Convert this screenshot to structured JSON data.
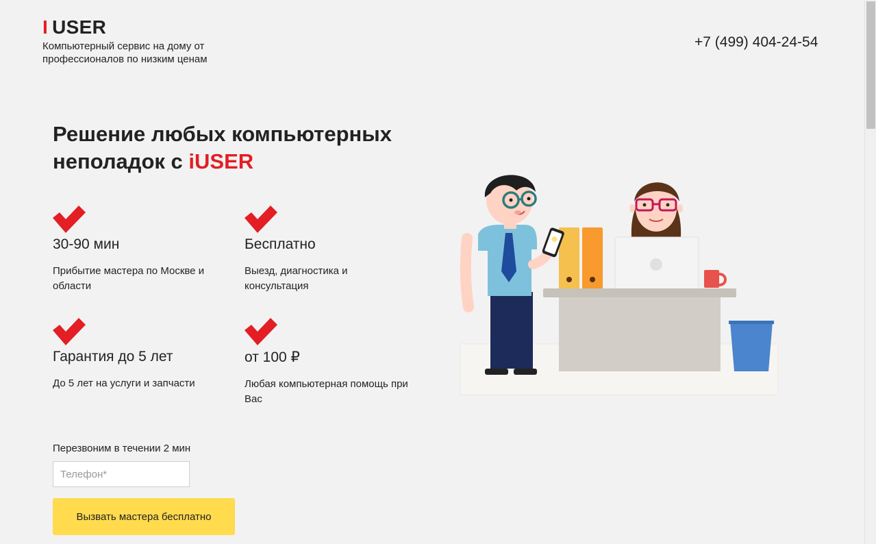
{
  "header": {
    "logo_mark": "I",
    "logo_text": "USER",
    "tagline": "Компьютерный сервис на дому от профессионалов по низким ценам",
    "phone": "+7 (499) 404-24-54"
  },
  "hero": {
    "title_prefix": "Решение любых компьютерных неполадок с ",
    "title_brand": "iUSER"
  },
  "features": [
    {
      "icon": "check-icon",
      "title": "30-90 мин",
      "description": "Прибытие мастера по Москве и области"
    },
    {
      "icon": "check-icon",
      "title": "Бесплатно",
      "description": "Выезд, диагностика и консультация"
    },
    {
      "icon": "check-icon",
      "title": "Гарантия до 5 лет",
      "description": "До 5 лет на услуги и запчасти"
    },
    {
      "icon": "check-icon",
      "title": "от 100 ₽",
      "description": "Любая компьютерная помощь при Вас"
    }
  ],
  "callback": {
    "label": "Перезвоним в течении 2 мин",
    "phone_placeholder": "Телефон*",
    "phone_value": "",
    "button_label": "Вызвать мастера бесплатно"
  },
  "colors": {
    "accent": "#e31e24",
    "button": "#ffdb4d",
    "background": "#f2f2f2"
  }
}
